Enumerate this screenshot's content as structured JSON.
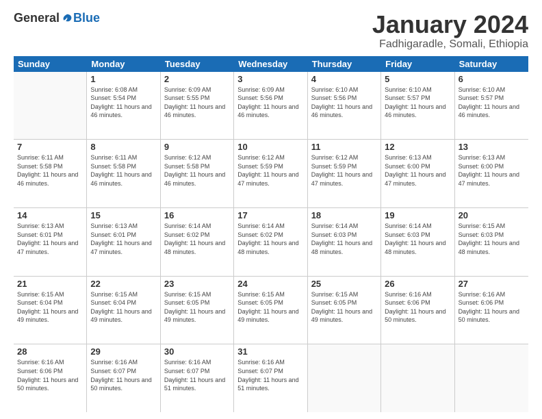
{
  "logo": {
    "general": "General",
    "blue": "Blue"
  },
  "header": {
    "title": "January 2024",
    "subtitle": "Fadhigaradle, Somali, Ethiopia"
  },
  "weekdays": [
    "Sunday",
    "Monday",
    "Tuesday",
    "Wednesday",
    "Thursday",
    "Friday",
    "Saturday"
  ],
  "weeks": [
    [
      {
        "day": "",
        "empty": true
      },
      {
        "day": "1",
        "sunrise": "6:08 AM",
        "sunset": "5:54 PM",
        "daylight": "11 hours and 46 minutes."
      },
      {
        "day": "2",
        "sunrise": "6:09 AM",
        "sunset": "5:55 PM",
        "daylight": "11 hours and 46 minutes."
      },
      {
        "day": "3",
        "sunrise": "6:09 AM",
        "sunset": "5:56 PM",
        "daylight": "11 hours and 46 minutes."
      },
      {
        "day": "4",
        "sunrise": "6:10 AM",
        "sunset": "5:56 PM",
        "daylight": "11 hours and 46 minutes."
      },
      {
        "day": "5",
        "sunrise": "6:10 AM",
        "sunset": "5:57 PM",
        "daylight": "11 hours and 46 minutes."
      },
      {
        "day": "6",
        "sunrise": "6:10 AM",
        "sunset": "5:57 PM",
        "daylight": "11 hours and 46 minutes."
      }
    ],
    [
      {
        "day": "7",
        "sunrise": "6:11 AM",
        "sunset": "5:58 PM",
        "daylight": "11 hours and 46 minutes."
      },
      {
        "day": "8",
        "sunrise": "6:11 AM",
        "sunset": "5:58 PM",
        "daylight": "11 hours and 46 minutes."
      },
      {
        "day": "9",
        "sunrise": "6:12 AM",
        "sunset": "5:58 PM",
        "daylight": "11 hours and 46 minutes."
      },
      {
        "day": "10",
        "sunrise": "6:12 AM",
        "sunset": "5:59 PM",
        "daylight": "11 hours and 47 minutes."
      },
      {
        "day": "11",
        "sunrise": "6:12 AM",
        "sunset": "5:59 PM",
        "daylight": "11 hours and 47 minutes."
      },
      {
        "day": "12",
        "sunrise": "6:13 AM",
        "sunset": "6:00 PM",
        "daylight": "11 hours and 47 minutes."
      },
      {
        "day": "13",
        "sunrise": "6:13 AM",
        "sunset": "6:00 PM",
        "daylight": "11 hours and 47 minutes."
      }
    ],
    [
      {
        "day": "14",
        "sunrise": "6:13 AM",
        "sunset": "6:01 PM",
        "daylight": "11 hours and 47 minutes."
      },
      {
        "day": "15",
        "sunrise": "6:13 AM",
        "sunset": "6:01 PM",
        "daylight": "11 hours and 47 minutes."
      },
      {
        "day": "16",
        "sunrise": "6:14 AM",
        "sunset": "6:02 PM",
        "daylight": "11 hours and 48 minutes."
      },
      {
        "day": "17",
        "sunrise": "6:14 AM",
        "sunset": "6:02 PM",
        "daylight": "11 hours and 48 minutes."
      },
      {
        "day": "18",
        "sunrise": "6:14 AM",
        "sunset": "6:03 PM",
        "daylight": "11 hours and 48 minutes."
      },
      {
        "day": "19",
        "sunrise": "6:14 AM",
        "sunset": "6:03 PM",
        "daylight": "11 hours and 48 minutes."
      },
      {
        "day": "20",
        "sunrise": "6:15 AM",
        "sunset": "6:03 PM",
        "daylight": "11 hours and 48 minutes."
      }
    ],
    [
      {
        "day": "21",
        "sunrise": "6:15 AM",
        "sunset": "6:04 PM",
        "daylight": "11 hours and 49 minutes."
      },
      {
        "day": "22",
        "sunrise": "6:15 AM",
        "sunset": "6:04 PM",
        "daylight": "11 hours and 49 minutes."
      },
      {
        "day": "23",
        "sunrise": "6:15 AM",
        "sunset": "6:05 PM",
        "daylight": "11 hours and 49 minutes."
      },
      {
        "day": "24",
        "sunrise": "6:15 AM",
        "sunset": "6:05 PM",
        "daylight": "11 hours and 49 minutes."
      },
      {
        "day": "25",
        "sunrise": "6:15 AM",
        "sunset": "6:05 PM",
        "daylight": "11 hours and 49 minutes."
      },
      {
        "day": "26",
        "sunrise": "6:16 AM",
        "sunset": "6:06 PM",
        "daylight": "11 hours and 50 minutes."
      },
      {
        "day": "27",
        "sunrise": "6:16 AM",
        "sunset": "6:06 PM",
        "daylight": "11 hours and 50 minutes."
      }
    ],
    [
      {
        "day": "28",
        "sunrise": "6:16 AM",
        "sunset": "6:06 PM",
        "daylight": "11 hours and 50 minutes."
      },
      {
        "day": "29",
        "sunrise": "6:16 AM",
        "sunset": "6:07 PM",
        "daylight": "11 hours and 50 minutes."
      },
      {
        "day": "30",
        "sunrise": "6:16 AM",
        "sunset": "6:07 PM",
        "daylight": "11 hours and 51 minutes."
      },
      {
        "day": "31",
        "sunrise": "6:16 AM",
        "sunset": "6:07 PM",
        "daylight": "11 hours and 51 minutes."
      },
      {
        "day": "",
        "empty": true
      },
      {
        "day": "",
        "empty": true
      },
      {
        "day": "",
        "empty": true
      }
    ]
  ],
  "labels": {
    "sunrise": "Sunrise:",
    "sunset": "Sunset:",
    "daylight": "Daylight:"
  }
}
